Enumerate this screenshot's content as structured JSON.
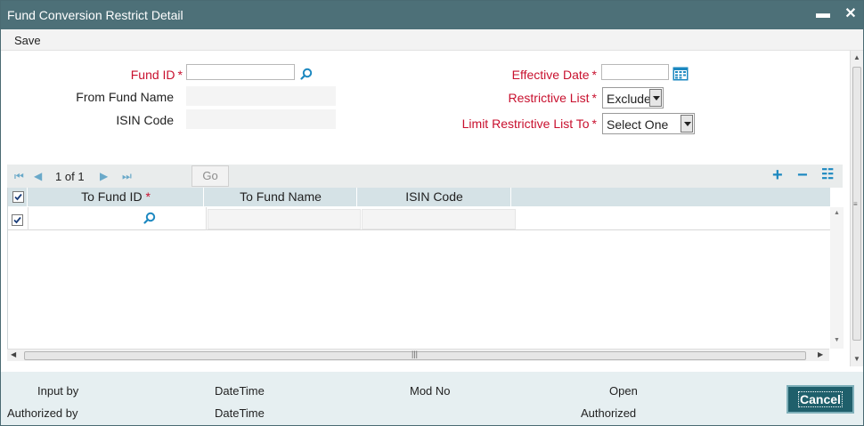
{
  "window": {
    "title": "Fund Conversion Restrict Detail",
    "minimize_glyph": "▬",
    "close_glyph": "✕"
  },
  "menu": {
    "save_label": "Save"
  },
  "form": {
    "fund_id": {
      "label": "Fund ID",
      "required_mark": "*",
      "value": ""
    },
    "from_fund_name": {
      "label": "From Fund Name",
      "value": ""
    },
    "isin_code": {
      "label": "ISIN Code",
      "value": ""
    },
    "effective_date": {
      "label": "Effective Date",
      "required_mark": "*",
      "value": ""
    },
    "restrictive_list": {
      "label": "Restrictive List",
      "required_mark": "*",
      "value": "Exclude"
    },
    "limit_restrictive_list_to": {
      "label": "Limit Restrictive List To",
      "required_mark": "*",
      "value": "Select One"
    }
  },
  "grid": {
    "pager": {
      "current": "1",
      "of_label": "of",
      "total": "1"
    },
    "go_label": "Go",
    "actions": {
      "add": "+",
      "remove": "−",
      "view": "☷"
    },
    "columns": [
      {
        "label": "To Fund ID",
        "required_mark": "*"
      },
      {
        "label": "To Fund Name"
      },
      {
        "label": "ISIN Code"
      }
    ],
    "header_checked": true,
    "rows": [
      {
        "checked": true,
        "to_fund_id": "",
        "to_fund_name": "",
        "isin_code": ""
      }
    ]
  },
  "footer": {
    "input_by": "Input by",
    "authorized_by": "Authorized by",
    "datetime_1": "DateTime",
    "datetime_2": "DateTime",
    "mod_no": "Mod No",
    "open": "Open",
    "authorized": "Authorized",
    "cancel_label": "Cancel"
  },
  "colors": {
    "titlebar": "#4d7078",
    "required_label": "#c8102e",
    "accent_icon": "#1c88c0",
    "cancel_button": "#1f5f6b",
    "grid_header": "#d5e2e6",
    "footer_bg": "#e6eff1"
  },
  "icons": [
    "search-icon",
    "calendar-icon",
    "first-page-icon",
    "prev-page-icon",
    "next-page-icon",
    "last-page-icon",
    "add-row-icon",
    "remove-row-icon",
    "single-view-icon",
    "minimize-icon",
    "close-icon"
  ]
}
